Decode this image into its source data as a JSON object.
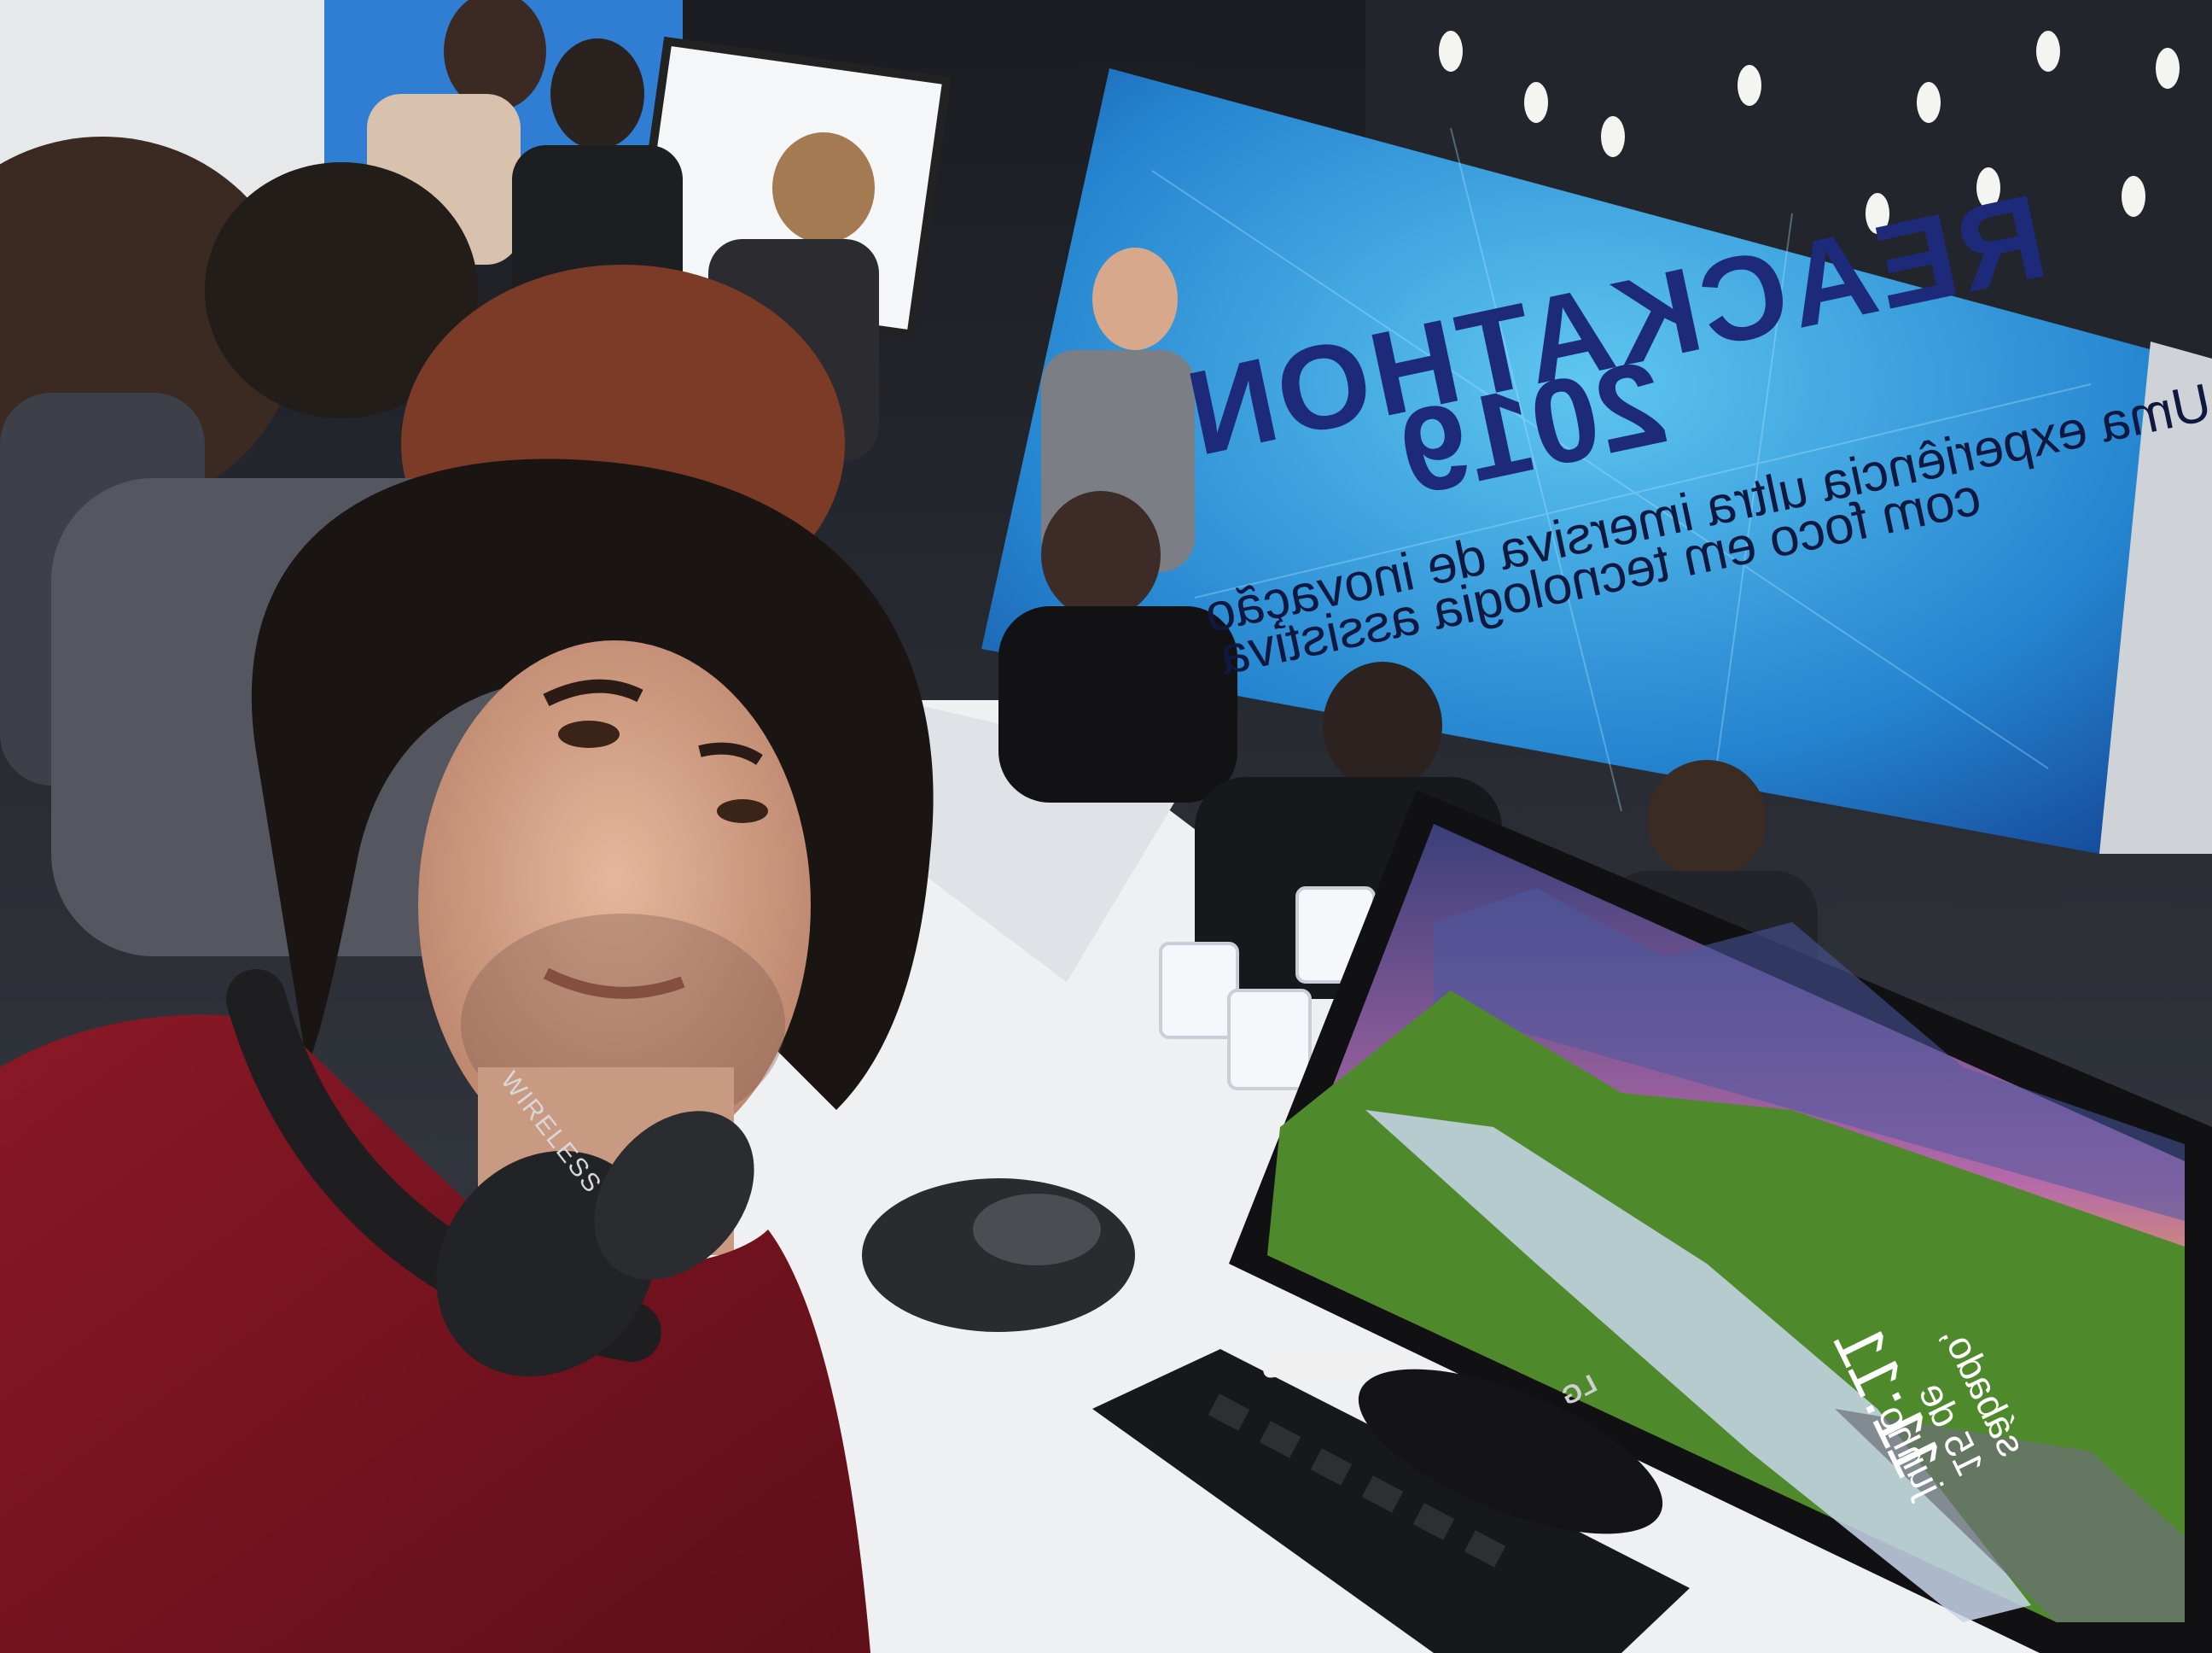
{
  "photo": {
    "banner": {
      "title": "REACKATHON",
      "year": "2019",
      "subtitle_line1": "Uma experiência ultra imersiva de inovação",
      "subtitle_line2": "com foco em tecnologia assistiva"
    },
    "monitor": {
      "brand": "LG",
      "lock_time": "11:11",
      "lock_date": "sábado, 15 de junho"
    },
    "headphones": {
      "label": "WIRELESS"
    },
    "colors": {
      "banner_blue": "#1f6fc4",
      "shirt": "#7a1420",
      "table": "#eef0f2"
    }
  }
}
